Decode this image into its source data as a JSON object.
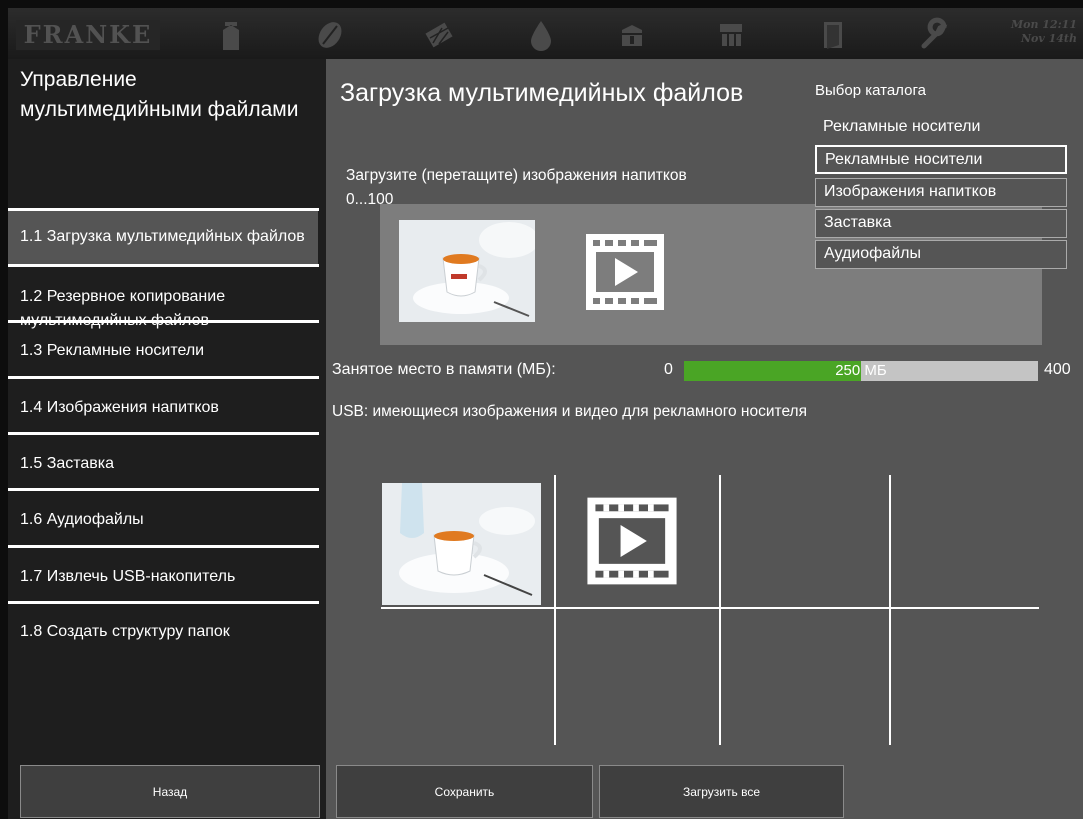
{
  "header": {
    "logo_text": "FRANKE",
    "clock_time": "Mon 12:11",
    "clock_date": "Nov 14th",
    "icons": [
      "milk-carton-icon",
      "coffee-bean-icon",
      "chocolate-icon",
      "water-drop-icon",
      "cleaning-icon",
      "cup-rack-icon",
      "door-icon",
      "wrench-icon"
    ]
  },
  "sidebar": {
    "title": "Управление мультимедийными файлами",
    "items": [
      {
        "label": "1.1 Загрузка мультимедийных файлов"
      },
      {
        "label": "1.2 Резервное копирование мультимедийных файлов"
      },
      {
        "label": "1.3 Рекламные носители"
      },
      {
        "label": "1.4 Изображения напитков"
      },
      {
        "label": "1.5 Заставка"
      },
      {
        "label": "1.6 Аудиофайлы"
      },
      {
        "label": "1.7 Извлечь USB-накопитель"
      },
      {
        "label": "1.8 Создать структуру папок"
      }
    ],
    "back_label": "Назад"
  },
  "main": {
    "title": "Загрузка мультимедийных файлов",
    "upload_hint": "Загрузите (перетащите) изображения напитков",
    "upload_range": "0...100",
    "catalog": {
      "label": "Выбор каталога",
      "selected": "Рекламные носители",
      "options": [
        "Рекламные носители",
        "Изображения напитков",
        "Заставка",
        "Аудиофайлы"
      ]
    },
    "memory": {
      "label": "Занятое место в памяти (МБ):",
      "min": "0",
      "max": "400",
      "used_text": "250 МБ",
      "used_fraction": 0.5
    },
    "usb_label": "USB: имеющиеся изображения и видео для рекламного носителя",
    "save_label": "Сохранить",
    "upload_all_label": "Загрузить все"
  },
  "colors": {
    "progress_fill": "#4aa525",
    "main_bg": "#555555",
    "sidebar_bg": "#1e1e1e"
  }
}
